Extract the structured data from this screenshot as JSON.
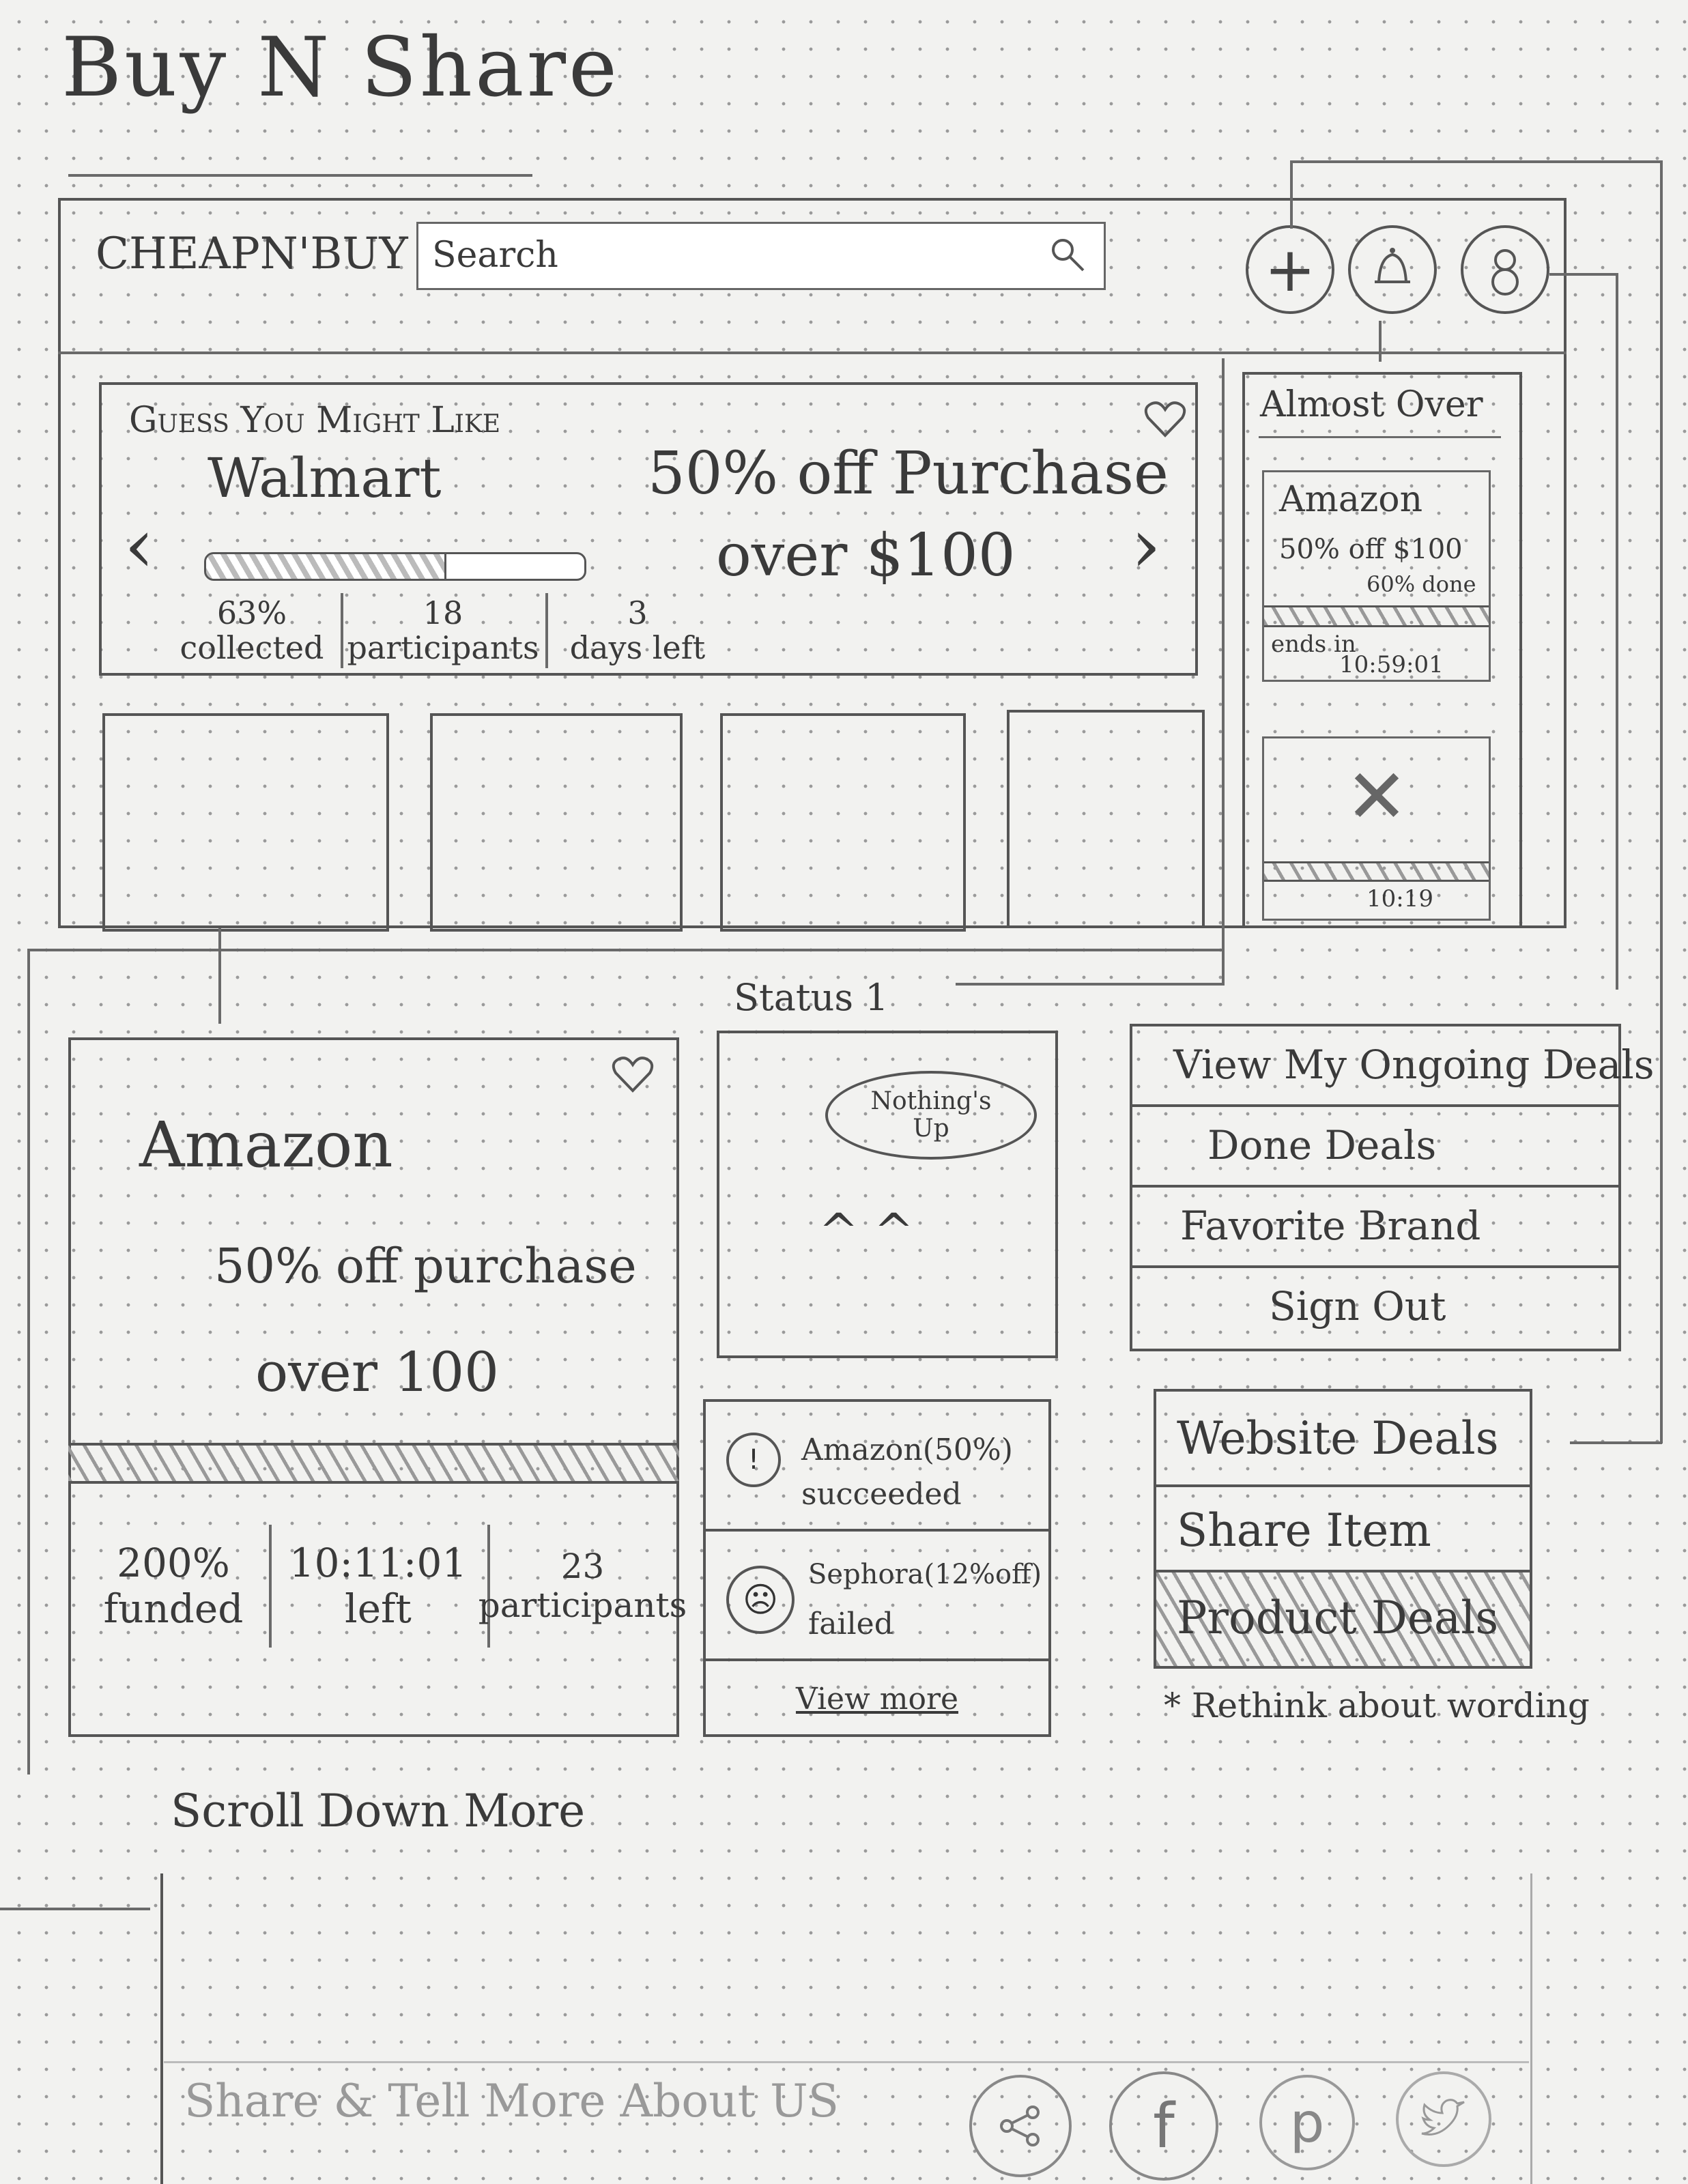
{
  "sketch_title": "Buy N Share",
  "header": {
    "logo": "CHEAPN'BUY",
    "search_placeholder": "Search"
  },
  "hero": {
    "heading": "Guess You Might Like",
    "brand": "Walmart",
    "deal_line1": "50% off Purchase",
    "deal_line2": "over $100",
    "progress": 0.63,
    "stat1_value": "63%",
    "stat1_label": "collected",
    "stat2_value": "18",
    "stat2_label": "participants",
    "stat3_value": "3",
    "stat3_label": "days left",
    "prev": "‹",
    "next": "›"
  },
  "almost_over": {
    "title": "Almost Over",
    "card1": {
      "brand": "Amazon",
      "offer": "50% off $100",
      "funded": "60% done",
      "ends_label": "ends in",
      "ends_time": "10:59:01"
    },
    "card2": {
      "mark": "✕",
      "time": "10:19"
    }
  },
  "deal_detail": {
    "brand": "Amazon",
    "line1": "50% off purchase",
    "line2": "over 100",
    "stat1_value": "200%",
    "stat1_label": "funded",
    "stat2_value": "10:11:01",
    "stat2_label": "left",
    "stat3_value": "23",
    "stat3_label": "participants"
  },
  "status": {
    "label": "Status 1",
    "bubble": "Nothing's Up",
    "face": "^ ^"
  },
  "notifications": {
    "items": [
      {
        "title": "Amazon(50%)",
        "status": "succeeded"
      },
      {
        "title": "Sephora(12%off)",
        "status": "failed"
      }
    ],
    "view_more": "View more"
  },
  "account_menu": {
    "items": [
      "View My Ongoing Deals",
      "Done Deals",
      "Favorite Brand",
      "Sign Out"
    ]
  },
  "add_menu": {
    "items": [
      "Website Deals",
      "Share Item",
      "Product Deals"
    ],
    "note": "* Rethink about wording"
  },
  "scroll_note": "Scroll Down More",
  "footer": {
    "text": "Share & Tell More About US"
  }
}
